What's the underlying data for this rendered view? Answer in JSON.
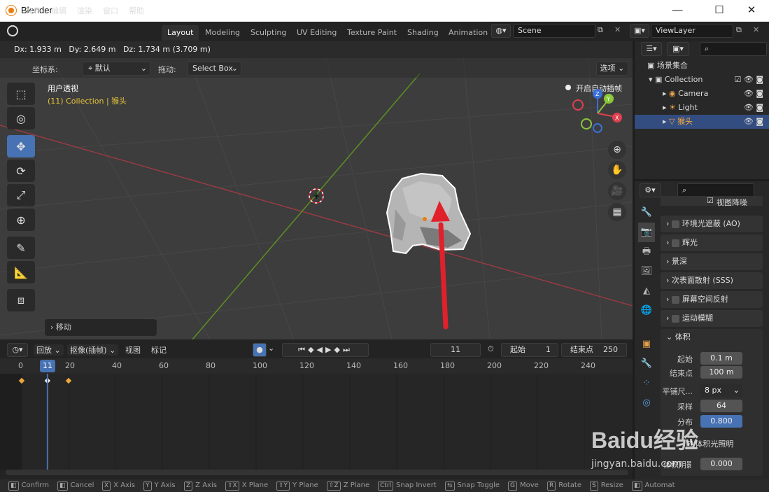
{
  "window": {
    "title": "Blender",
    "minimize": "—",
    "maximize": "☐",
    "close": "✕"
  },
  "menu": [
    "文件",
    "编辑",
    "渲染",
    "窗口",
    "帮助"
  ],
  "workspaces": [
    "Layout",
    "Modeling",
    "Sculpting",
    "UV Editing",
    "Texture Paint",
    "Shading",
    "Animation"
  ],
  "active_workspace": "Layout",
  "scene": {
    "name": "Scene"
  },
  "view_layer": {
    "name": "ViewLayer"
  },
  "viewport": {
    "move_info": "Dx: 1.933 m   Dy: 2.649 m   Dz: 1.734 m (3.709 m)",
    "coord_label": "坐标系:",
    "coord_value": "默认",
    "drag_label": "拖动:",
    "drag_value": "Select Box",
    "options": "选项",
    "view_name": "用户透视",
    "collection_info": "(11) Collection | 猴头",
    "auto_keying": "开启自动插帧",
    "last_op": "移动",
    "gizmo": {
      "z": "Z",
      "y": "Y",
      "x": "X"
    }
  },
  "timeline": {
    "playback": "回放",
    "keying": "抠像(插帧)",
    "view": "视图",
    "marker": "标记",
    "current_frame": "11",
    "start_label": "起始",
    "start": "1",
    "end_label": "结束点",
    "end": "250",
    "ruler_ticks": [
      "0",
      "20",
      "40",
      "60",
      "80",
      "100",
      "120",
      "140",
      "160",
      "180",
      "200",
      "220",
      "240"
    ],
    "keyframes": [
      0,
      11,
      20
    ]
  },
  "status": [
    {
      "key": "",
      "label": "Confirm"
    },
    {
      "key": "",
      "label": "Cancel"
    },
    {
      "key": "X",
      "label": "X Axis"
    },
    {
      "key": "Y",
      "label": "Y Axis"
    },
    {
      "key": "Z",
      "label": "Z Axis"
    },
    {
      "key": "⇧X",
      "label": "X Plane"
    },
    {
      "key": "⇧Y",
      "label": "Y Plane"
    },
    {
      "key": "⇧Z",
      "label": "Z Plane"
    },
    {
      "key": "Ctrl",
      "label": "Snap Invert"
    },
    {
      "key": "⇆",
      "label": "Snap Toggle"
    },
    {
      "key": "G",
      "label": "Move"
    },
    {
      "key": "R",
      "label": "Rotate"
    },
    {
      "key": "S",
      "label": "Resize"
    },
    {
      "key": "",
      "label": "Automat"
    }
  ],
  "outliner": {
    "root": "场景集合",
    "collection": "Collection",
    "items": [
      "Camera",
      "Light",
      "猴头"
    ]
  },
  "properties": {
    "top_item": "视图降噪",
    "panels": [
      "环境光遮蔽 (AO)",
      "辉光",
      "景深",
      "次表面散射 (SSS)",
      "屏幕空间反射",
      "运动模糊"
    ],
    "volume": {
      "title": "体积",
      "start_label": "起始",
      "start": "0.1 m",
      "end_label": "结束点",
      "end": "100 m",
      "tile_label": "平铺尺...",
      "tile": "8 px",
      "samples_label": "采样",
      "samples": "64",
      "dist_label": "分布",
      "dist": "0.800",
      "lighting_label": "体积光照明",
      "shadows_label": "体积阴影",
      "shadow_val": "0.000"
    }
  },
  "watermark": {
    "text": "Baidu经验",
    "sub": "jingyan.baidu.com"
  },
  "colors": {
    "accent": "#4772b3",
    "selected": "#e87d0d",
    "annotation_arrow": "#e0212b",
    "x_axis": "#c0393e",
    "y_axis": "#6a9a23"
  }
}
